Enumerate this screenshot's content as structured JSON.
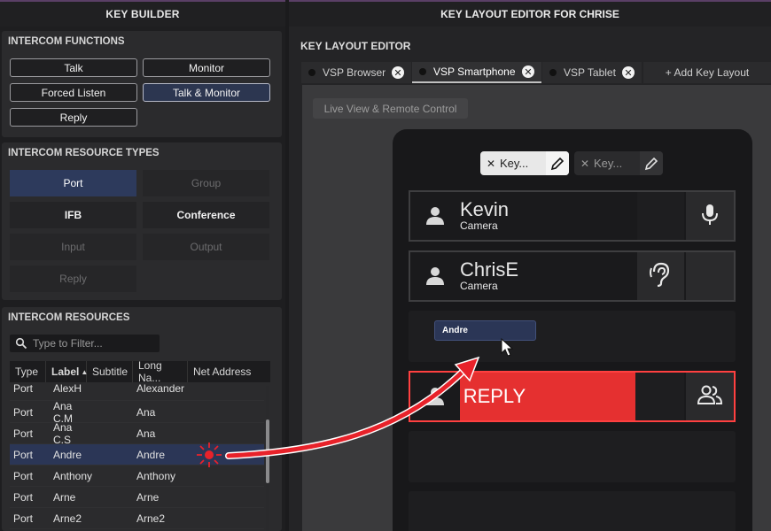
{
  "left": {
    "header": "KEY BUILDER",
    "functions": {
      "title": "INTERCOM FUNCTIONS",
      "buttons": [
        "Talk",
        "Monitor",
        "Forced Listen",
        "Talk & Monitor",
        "Reply"
      ]
    },
    "resource_types": {
      "title": "INTERCOM RESOURCE TYPES",
      "buttons": [
        "Port",
        "Group",
        "IFB",
        "Conference",
        "Input",
        "Output",
        "Reply"
      ]
    },
    "resources": {
      "title": "INTERCOM RESOURCES",
      "filter_placeholder": "Type to Filter...",
      "columns": [
        "Type",
        "Label",
        "Subtitle",
        "Long Na...",
        "Net Address"
      ],
      "rows": [
        {
          "type": "Port",
          "label": "AlexH",
          "subtitle": "",
          "long": "Alexander"
        },
        {
          "type": "Port",
          "label": "Ana C.M",
          "subtitle": "",
          "long": "Ana"
        },
        {
          "type": "Port",
          "label": "Ana C.S",
          "subtitle": "",
          "long": "Ana"
        },
        {
          "type": "Port",
          "label": "Andre",
          "subtitle": "",
          "long": "Andre"
        },
        {
          "type": "Port",
          "label": "Anthony",
          "subtitle": "",
          "long": "Anthony"
        },
        {
          "type": "Port",
          "label": "Arne",
          "subtitle": "",
          "long": "Arne"
        },
        {
          "type": "Port",
          "label": "Arne2",
          "subtitle": "",
          "long": "Arne2"
        }
      ]
    }
  },
  "right": {
    "header": "KEY LAYOUT EDITOR FOR CHRISE",
    "editor_title": "KEY LAYOUT EDITOR",
    "tabs": [
      "VSP Browser",
      "VSP Smartphone",
      "VSP Tablet"
    ],
    "add_layout": "+ Add Key Layout",
    "live_view": "Live View & Remote Control",
    "chips": [
      "Key...",
      "Key..."
    ],
    "keys": [
      {
        "name": "Kevin",
        "sub": "Camera"
      },
      {
        "name": "ChrisE",
        "sub": "Camera"
      }
    ],
    "reply_label": "REPLY",
    "drag_label": "Andre"
  },
  "colors": {
    "accent_purple": "#5a3f66",
    "selected_blue": "#2b3656",
    "reply_red": "#e53030",
    "arrow_red": "#e8222a"
  }
}
